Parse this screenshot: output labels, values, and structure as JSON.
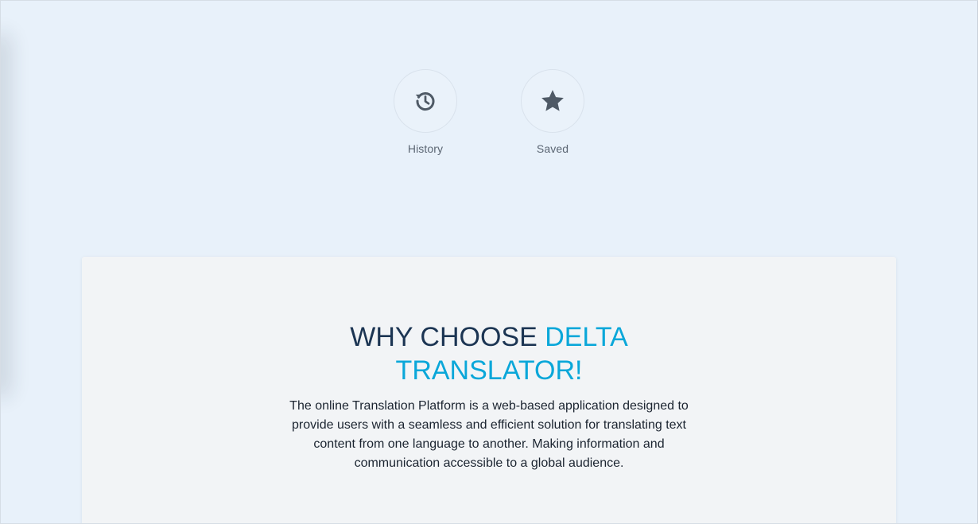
{
  "quick_actions": {
    "history": {
      "label": "History",
      "icon": "history-icon"
    },
    "saved": {
      "label": "Saved",
      "icon": "star-icon"
    }
  },
  "why_section": {
    "title_prefix": "WHY CHOOSE ",
    "title_accent_line1": "DELTA",
    "title_accent_line2": "TRANSLATOR!",
    "description": "The online Translation Platform is a web-based application designed to provide users with a seamless and efficient solution for translating text content from one language to another. Making information and communication accessible to a global audience."
  },
  "colors": {
    "page_background": "#e8f1fa",
    "card_background": "#f2f4f6",
    "title_dark": "#1c3553",
    "title_accent": "#0aa7d9",
    "icon_color": "#4f5a66",
    "label_color": "#5b6673"
  }
}
